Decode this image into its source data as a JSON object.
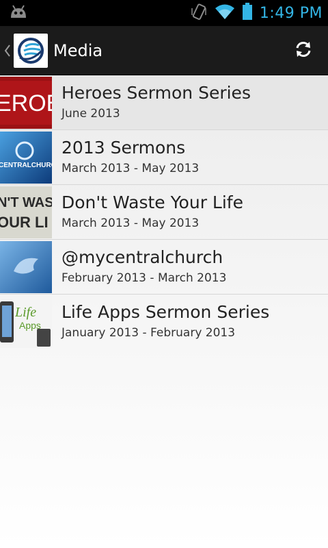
{
  "status_bar": {
    "time": "1:49 PM",
    "icons": [
      "android-icon",
      "vibrate-icon",
      "wifi-icon",
      "battery-icon"
    ]
  },
  "action_bar": {
    "title": "Media",
    "up_icon": "chevron-left-icon",
    "app_icon": "church-logo-icon",
    "refresh_icon": "refresh-icon"
  },
  "media_list": [
    {
      "title": "Heroes Sermon Series",
      "subtitle": "June 2013",
      "thumb_text": "EROE"
    },
    {
      "title": "2013 Sermons",
      "subtitle": "March 2013 - May 2013",
      "thumb_text": "CENTRALCHURCH"
    },
    {
      "title": "Don't Waste Your Life",
      "subtitle": "March 2013 - May 2013",
      "thumb_text": "N'T WAS OUR LI"
    },
    {
      "title": "@mycentralchurch",
      "subtitle": "February 2013 - March 2013",
      "thumb_text": ""
    },
    {
      "title": "Life Apps Sermon Series",
      "subtitle": "January 2013 - February 2013",
      "thumb_text": "Life Apps"
    }
  ],
  "colors": {
    "clock": "#33b5e5",
    "action_bar": "#1b1b1b",
    "status_bar": "#000000"
  }
}
